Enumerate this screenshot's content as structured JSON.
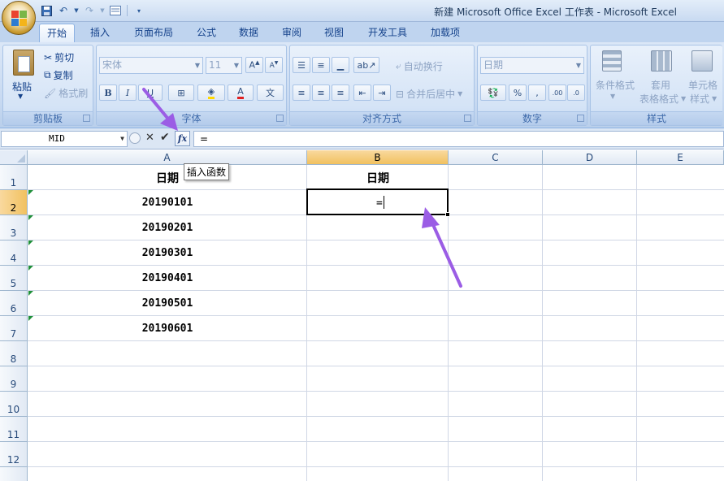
{
  "window": {
    "title": "新建 Microsoft Office Excel 工作表 - Microsoft Excel"
  },
  "tabs": [
    {
      "label": "开始",
      "active": true
    },
    {
      "label": "插入"
    },
    {
      "label": "页面布局"
    },
    {
      "label": "公式"
    },
    {
      "label": "数据"
    },
    {
      "label": "审阅"
    },
    {
      "label": "视图"
    },
    {
      "label": "开发工具"
    },
    {
      "label": "加载项"
    }
  ],
  "ribbon": {
    "clipboard": {
      "label": "剪贴板",
      "paste": "粘贴",
      "cut": "剪切",
      "copy": "复制",
      "format_painter": "格式刷"
    },
    "font": {
      "label": "字体",
      "font_name": "宋体",
      "font_size": "11"
    },
    "alignment": {
      "label": "对齐方式",
      "wrap_text": "自动换行",
      "merge_center": "合并后居中"
    },
    "number": {
      "label": "数字",
      "format": "日期"
    },
    "styles": {
      "label": "样式",
      "conditional_1": "条件格式",
      "table_1": "套用",
      "table_2": "表格格式",
      "cell_1": "单元格",
      "cell_2": "样式"
    }
  },
  "formula_bar": {
    "name_box": "MID",
    "content": "="
  },
  "tooltip": "插入函数",
  "columns": [
    "A",
    "B",
    "C",
    "D",
    "E"
  ],
  "rows": [
    "1",
    "2",
    "3",
    "4",
    "5",
    "6",
    "7",
    "8",
    "9",
    "10",
    "11",
    "12"
  ],
  "cells": {
    "A1": "日期",
    "B1": "日期",
    "A2": "20190101",
    "A3": "20190201",
    "A4": "20190301",
    "A5": "20190401",
    "A6": "20190501",
    "A7": "20190601",
    "B2": "="
  },
  "colors": {
    "arrow": "#9b5de5",
    "selected_header": "#f1c15f",
    "ribbon": "#c7d9f1"
  }
}
